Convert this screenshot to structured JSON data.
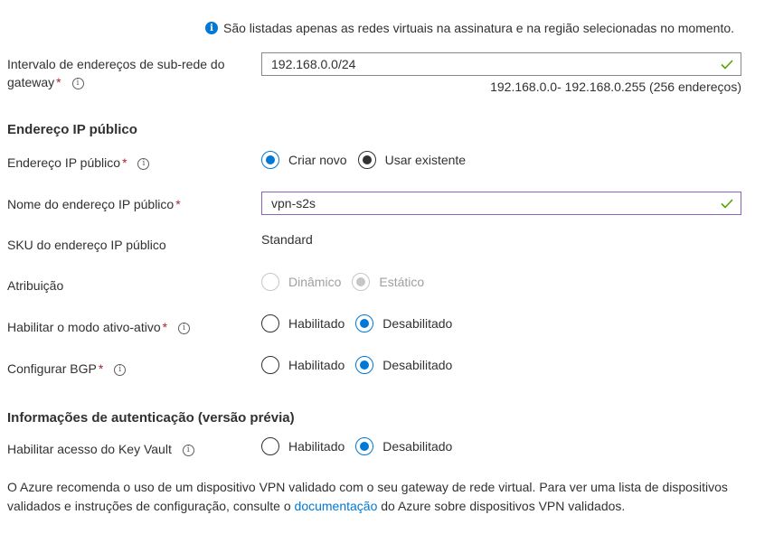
{
  "info_banner": "São listadas apenas as redes virtuais na assinatura e na região selecionadas no momento.",
  "subnet_range": {
    "label_line1": "Intervalo de endereços de sub-rede do",
    "label_line2": "gateway",
    "value": "192.168.0.0/24",
    "hint": "192.168.0.0- 192.168.0.255 (256 endereços)"
  },
  "section_public_ip": "Endereço IP público",
  "public_ip": {
    "label": "Endereço IP público",
    "options": [
      "Criar novo",
      "Usar existente"
    ],
    "selected": "Criar novo"
  },
  "public_ip_name": {
    "label": "Nome do endereço IP público",
    "value": "vpn-s2s"
  },
  "sku": {
    "label": "SKU do endereço IP público",
    "value": "Standard"
  },
  "assignment": {
    "label": "Atribuição",
    "options": [
      "Dinâmico",
      "Estático"
    ],
    "selected": "Estático"
  },
  "active_active": {
    "label": "Habilitar o modo ativo-ativo",
    "options": [
      "Habilitado",
      "Desabilitado"
    ],
    "selected": "Desabilitado"
  },
  "bgp": {
    "label": "Configurar BGP",
    "options": [
      "Habilitado",
      "Desabilitado"
    ],
    "selected": "Desabilitado"
  },
  "section_auth": "Informações de autenticação (versão prévia)",
  "key_vault": {
    "label": "Habilitar acesso do Key Vault",
    "options": [
      "Habilitado",
      "Desabilitado"
    ],
    "selected": "Desabilitado"
  },
  "footer": {
    "text_before": "O Azure recomenda o uso de um dispositivo VPN validado com o seu gateway de rede virtual. Para ver uma lista de dispositivos validados e instruções de configuração, consulte o ",
    "link": "documentação",
    "text_after": " do Azure sobre dispositivos VPN validados."
  },
  "required_mark": "*",
  "colors": {
    "accent": "#0078d4",
    "required": "#a4262c",
    "valid_check": "#57a300",
    "focus_border": "#8764b8"
  },
  "icons": [
    "info-icon",
    "tooltip-icon",
    "checkmark-icon"
  ]
}
